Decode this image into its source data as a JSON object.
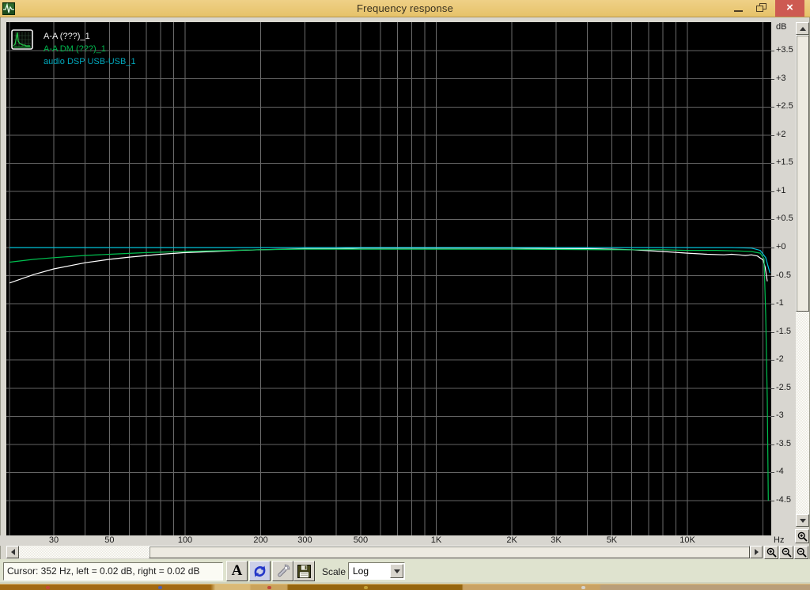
{
  "window": {
    "title": "Frequency response",
    "close_glyph": "×"
  },
  "legend": {
    "series": [
      {
        "label": "A-A (???)_1",
        "color": "#f2f2f2"
      },
      {
        "label": "A-A DM (???)_1",
        "color": "#00b44c"
      },
      {
        "label": "audio DSP USB-USB_1",
        "color": "#00a8bc"
      }
    ]
  },
  "axes": {
    "y_unit": "dB",
    "x_unit": "Hz"
  },
  "statusbar": {
    "cursor_text": "Cursor:  352 Hz,  left = 0.02 dB,  right = 0.02 dB"
  },
  "toolbar": {
    "font_button_label": "A",
    "scale_label": "Scale",
    "scale_value": "Log"
  },
  "chart_data": {
    "type": "line",
    "title": "Frequency response",
    "x_scale": "log",
    "xlabel": "Hz",
    "ylabel": "dB",
    "x_range": [
      20,
      21500
    ],
    "y_range": [
      -5.05,
      4.0
    ],
    "grid": true,
    "legend_position": "top-left",
    "x_gridlines": [
      20,
      30,
      40,
      50,
      60,
      70,
      80,
      90,
      100,
      200,
      300,
      400,
      500,
      600,
      700,
      800,
      900,
      1000,
      2000,
      3000,
      4000,
      5000,
      6000,
      7000,
      8000,
      9000,
      10000,
      20000
    ],
    "x_ticks": [
      {
        "f": 30,
        "label": "30"
      },
      {
        "f": 50,
        "label": "50"
      },
      {
        "f": 100,
        "label": "100"
      },
      {
        "f": 200,
        "label": "200"
      },
      {
        "f": 300,
        "label": "300"
      },
      {
        "f": 500,
        "label": "500"
      },
      {
        "f": 1000,
        "label": "1K"
      },
      {
        "f": 2000,
        "label": "2K"
      },
      {
        "f": 3000,
        "label": "3K"
      },
      {
        "f": 5000,
        "label": "5K"
      },
      {
        "f": 10000,
        "label": "10K"
      }
    ],
    "y_tick_max": 3.5,
    "y_tick_min": -4.5,
    "y_tick_step": 0.5,
    "series": [
      {
        "name": "A-A (???)_1",
        "color": "#ffffff",
        "points": [
          [
            20,
            -0.63
          ],
          [
            25,
            -0.48
          ],
          [
            30,
            -0.38
          ],
          [
            40,
            -0.27
          ],
          [
            50,
            -0.21
          ],
          [
            60,
            -0.17
          ],
          [
            80,
            -0.12
          ],
          [
            100,
            -0.09
          ],
          [
            130,
            -0.07
          ],
          [
            160,
            -0.05
          ],
          [
            200,
            -0.04
          ],
          [
            250,
            -0.03
          ],
          [
            300,
            -0.02
          ],
          [
            400,
            -0.02
          ],
          [
            500,
            -0.01
          ],
          [
            700,
            -0.01
          ],
          [
            1000,
            -0.01
          ],
          [
            1500,
            -0.01
          ],
          [
            2000,
            -0.01
          ],
          [
            3000,
            -0.02
          ],
          [
            4000,
            -0.02
          ],
          [
            5000,
            -0.03
          ],
          [
            6000,
            -0.04
          ],
          [
            8000,
            -0.07
          ],
          [
            10000,
            -0.1
          ],
          [
            12000,
            -0.12
          ],
          [
            14000,
            -0.13
          ],
          [
            15000,
            -0.12
          ],
          [
            16000,
            -0.13
          ],
          [
            17000,
            -0.14
          ],
          [
            18000,
            -0.13
          ],
          [
            19000,
            -0.15
          ],
          [
            20000,
            -0.22
          ],
          [
            20400,
            -0.35
          ],
          [
            20800,
            -0.6
          ]
        ]
      },
      {
        "name": "A-A DM (???)_1",
        "color": "#00c050",
        "points": [
          [
            20,
            -0.26
          ],
          [
            25,
            -0.21
          ],
          [
            30,
            -0.18
          ],
          [
            40,
            -0.14
          ],
          [
            50,
            -0.12
          ],
          [
            70,
            -0.09
          ],
          [
            100,
            -0.07
          ],
          [
            150,
            -0.05
          ],
          [
            200,
            -0.04
          ],
          [
            300,
            -0.03
          ],
          [
            500,
            -0.03
          ],
          [
            1000,
            -0.03
          ],
          [
            2000,
            -0.03
          ],
          [
            5000,
            -0.04
          ],
          [
            8000,
            -0.04
          ],
          [
            10000,
            -0.05
          ],
          [
            13000,
            -0.05
          ],
          [
            16000,
            -0.06
          ],
          [
            18000,
            -0.07
          ],
          [
            19500,
            -0.1
          ],
          [
            20200,
            -0.2
          ],
          [
            20500,
            -1.2
          ],
          [
            20800,
            -2.7
          ],
          [
            21000,
            -4.5
          ]
        ]
      },
      {
        "name": "audio DSP USB-USB_1",
        "color": "#00c4d8",
        "points": [
          [
            20,
            0
          ],
          [
            100,
            0
          ],
          [
            1000,
            0
          ],
          [
            5000,
            0
          ],
          [
            10000,
            0
          ],
          [
            15000,
            0
          ],
          [
            18000,
            -0.01
          ],
          [
            19500,
            -0.05
          ],
          [
            20500,
            -0.18
          ],
          [
            21300,
            -0.45
          ]
        ]
      }
    ]
  }
}
